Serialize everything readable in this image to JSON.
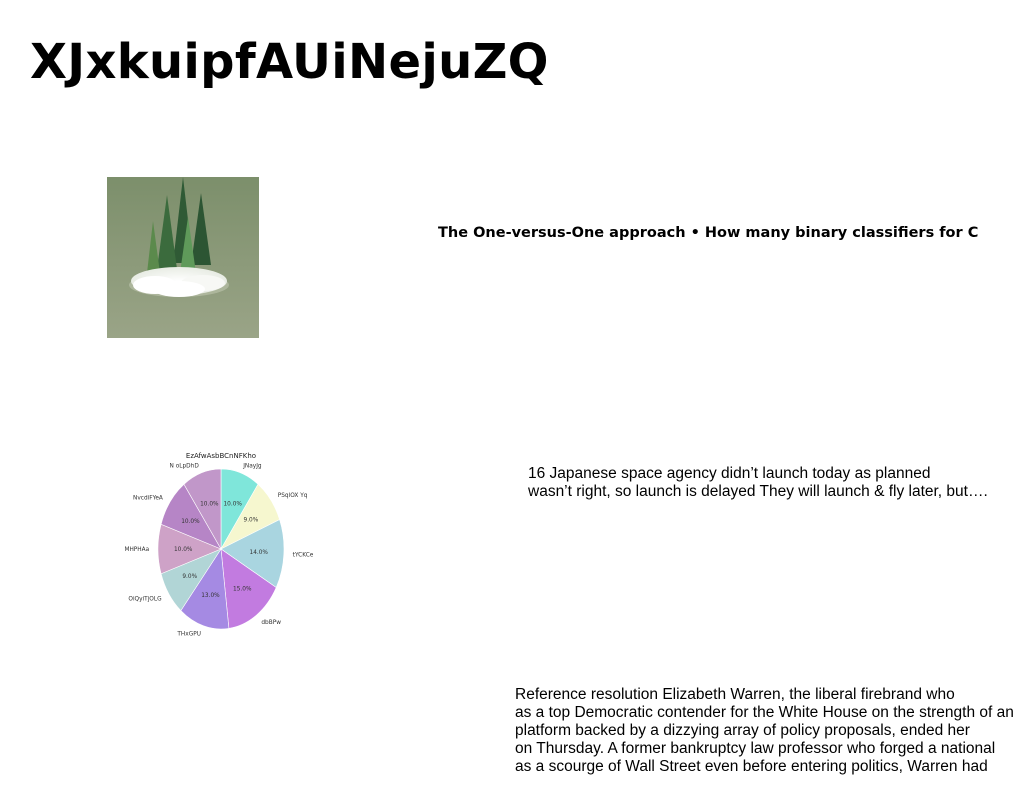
{
  "page": {
    "title": "XJxkuipfAUiNejuZQ"
  },
  "heading_line": "The One-versus-One approach • How many binary classifiers for C",
  "paragraph_a": [
    "16 Japanese space agency didn’t launch today as planned",
    "wasn’t right, so launch is delayed They will launch & fly later, but…."
  ],
  "paragraph_b": [
    "Reference resolution Elizabeth Warren, the liberal firebrand who",
    "as a top Democratic contender for the White House on the strength of an",
    "platform backed by a dizzying array of policy proposals, ended her",
    "on Thursday. A former bankruptcy law professor who forged a national",
    "as a scourge of Wall Street even before entering politics, Warren had"
  ],
  "chart_data": {
    "type": "pie",
    "title": "EzAfwAsbBCnNFKho",
    "slices": [
      {
        "label": "JNayJg",
        "value": 10.0,
        "pct_label": "10.0%",
        "color": "#7fe6da"
      },
      {
        "label": "PSqlOX Yq",
        "value": 9.0,
        "pct_label": "9.0%",
        "color": "#f6f7cf"
      },
      {
        "label": "tYCKCe",
        "value": 14.0,
        "pct_label": "14.0%",
        "color": "#a9d5e0"
      },
      {
        "label": "dbBPw",
        "value": 15.0,
        "pct_label": "15.0%",
        "color": "#c27be0"
      },
      {
        "label": "THxGPU",
        "value": 13.0,
        "pct_label": "13.0%",
        "color": "#a58ae3"
      },
      {
        "label": "OiQyiTjOLG",
        "value": 9.0,
        "pct_label": "9.0%",
        "color": "#b1d5d6"
      },
      {
        "label": "MHPHAa",
        "value": 10.0,
        "pct_label": "10.0%",
        "color": "#cea2c7"
      },
      {
        "label": "NvcdiFYeA",
        "value": 10.0,
        "pct_label": "10.0%",
        "color": "#b685c6"
      },
      {
        "label": "N oLpDhD",
        "value": 10.0,
        "pct_label": "10.0%",
        "color": "#c197c9"
      }
    ]
  }
}
